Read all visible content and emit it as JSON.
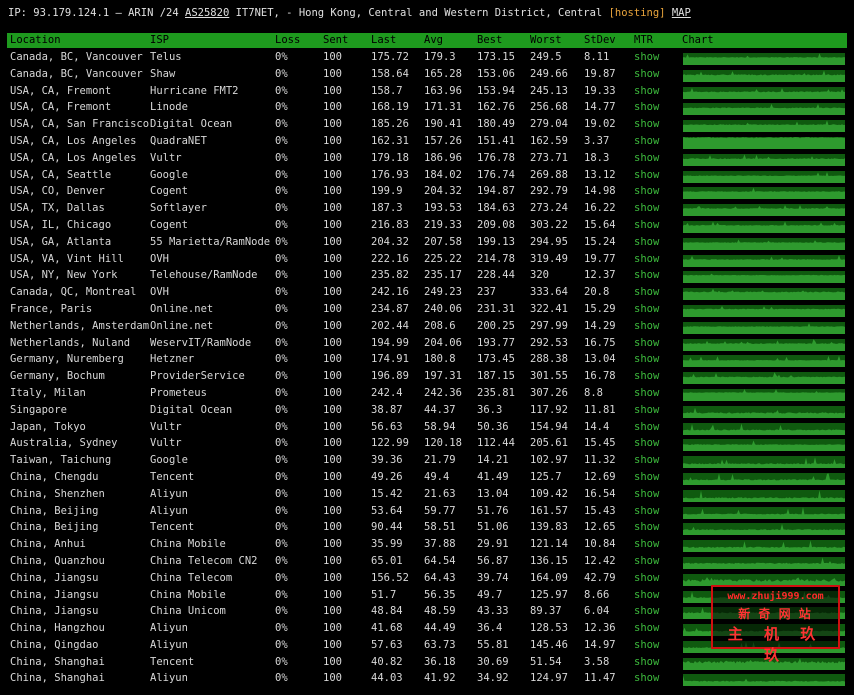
{
  "info": {
    "prefix": "IP: 93.179.124.1 – ARIN /24 ",
    "asn": "AS25820",
    "mid": " IT7NET, - Hong Kong, Central and Western District, Central ",
    "hosting": "hosting",
    "map": "MAP"
  },
  "columns": [
    "Location",
    "ISP",
    "Loss",
    "Sent",
    "Last",
    "Avg",
    "Best",
    "Worst",
    "StDev",
    "MTR",
    "Chart"
  ],
  "colors": {
    "header_bg": "#1e9a1e",
    "chart_green": "#2e9a2e",
    "chart_bg": "#0f5a0f",
    "mtr_link": "#3dbb3d",
    "hosting": "#e8a33b"
  },
  "rows": [
    [
      "Canada, BC, Vancouver",
      "Telus",
      "0%",
      "100",
      "175.72",
      "179.3",
      "173.15",
      "249.5",
      "8.11",
      "show"
    ],
    [
      "Canada, BC, Vancouver",
      "Shaw",
      "0%",
      "100",
      "158.64",
      "165.28",
      "153.06",
      "249.66",
      "19.87",
      "show"
    ],
    [
      "USA, CA, Fremont",
      "Hurricane FMT2",
      "0%",
      "100",
      "158.7",
      "163.96",
      "153.94",
      "245.13",
      "19.33",
      "show"
    ],
    [
      "USA, CA, Fremont",
      "Linode",
      "0%",
      "100",
      "168.19",
      "171.31",
      "162.76",
      "256.68",
      "14.77",
      "show"
    ],
    [
      "USA, CA, San Francisco",
      "Digital Ocean",
      "0%",
      "100",
      "185.26",
      "190.41",
      "180.49",
      "279.04",
      "19.02",
      "show"
    ],
    [
      "USA, CA, Los Angeles",
      "QuadraNET",
      "0%",
      "100",
      "162.31",
      "157.26",
      "151.41",
      "162.59",
      "3.37",
      "show"
    ],
    [
      "USA, CA, Los Angeles",
      "Vultr",
      "0%",
      "100",
      "179.18",
      "186.96",
      "176.78",
      "273.71",
      "18.3",
      "show"
    ],
    [
      "USA, CA, Seattle",
      "Google",
      "0%",
      "100",
      "176.93",
      "184.02",
      "176.74",
      "269.88",
      "13.12",
      "show"
    ],
    [
      "USA, CO, Denver",
      "Cogent",
      "0%",
      "100",
      "199.9",
      "204.32",
      "194.87",
      "292.79",
      "14.98",
      "show"
    ],
    [
      "USA, TX, Dallas",
      "Softlayer",
      "0%",
      "100",
      "187.3",
      "193.53",
      "184.63",
      "273.24",
      "16.22",
      "show"
    ],
    [
      "USA, IL, Chicago",
      "Cogent",
      "0%",
      "100",
      "216.83",
      "219.33",
      "209.08",
      "303.22",
      "15.64",
      "show"
    ],
    [
      "USA, GA, Atlanta",
      "55 Marietta/RamNode",
      "0%",
      "100",
      "204.32",
      "207.58",
      "199.13",
      "294.95",
      "15.24",
      "show"
    ],
    [
      "USA, VA, Vint Hill",
      "OVH",
      "0%",
      "100",
      "222.16",
      "225.22",
      "214.78",
      "319.49",
      "19.77",
      "show"
    ],
    [
      "USA, NY, New York",
      "Telehouse/RamNode",
      "0%",
      "100",
      "235.82",
      "235.17",
      "228.44",
      "320",
      "12.37",
      "show"
    ],
    [
      "Canada, QC, Montreal",
      "OVH",
      "0%",
      "100",
      "242.16",
      "249.23",
      "237",
      "333.64",
      "20.8",
      "show"
    ],
    [
      "France, Paris",
      "Online.net",
      "0%",
      "100",
      "234.87",
      "240.06",
      "231.31",
      "322.41",
      "15.29",
      "show"
    ],
    [
      "Netherlands, Amsterdam",
      "Online.net",
      "0%",
      "100",
      "202.44",
      "208.6",
      "200.25",
      "297.99",
      "14.29",
      "show"
    ],
    [
      "Netherlands, Nuland",
      "WeservIT/RamNode",
      "0%",
      "100",
      "194.99",
      "204.06",
      "193.77",
      "292.53",
      "16.75",
      "show"
    ],
    [
      "Germany, Nuremberg",
      "Hetzner",
      "0%",
      "100",
      "174.91",
      "180.8",
      "173.45",
      "288.38",
      "13.04",
      "show"
    ],
    [
      "Germany, Bochum",
      "ProviderService",
      "0%",
      "100",
      "196.89",
      "197.31",
      "187.15",
      "301.55",
      "16.78",
      "show"
    ],
    [
      "Italy, Milan",
      "Prometeus",
      "0%",
      "100",
      "242.4",
      "242.36",
      "235.81",
      "307.26",
      "8.8",
      "show"
    ],
    [
      "Singapore",
      "Digital Ocean",
      "0%",
      "100",
      "38.87",
      "44.37",
      "36.3",
      "117.92",
      "11.81",
      "show"
    ],
    [
      "Japan, Tokyo",
      "Vultr",
      "0%",
      "100",
      "56.63",
      "58.94",
      "50.36",
      "154.94",
      "14.4",
      "show"
    ],
    [
      "Australia, Sydney",
      "Vultr",
      "0%",
      "100",
      "122.99",
      "120.18",
      "112.44",
      "205.61",
      "15.45",
      "show"
    ],
    [
      "Taiwan, Taichung",
      "Google",
      "0%",
      "100",
      "39.36",
      "21.79",
      "14.21",
      "102.97",
      "11.32",
      "show"
    ],
    [
      "China, Chengdu",
      "Tencent",
      "0%",
      "100",
      "49.26",
      "49.4",
      "41.49",
      "125.7",
      "12.69",
      "show"
    ],
    [
      "China, Shenzhen",
      "Aliyun",
      "0%",
      "100",
      "15.42",
      "21.63",
      "13.04",
      "109.42",
      "16.54",
      "show"
    ],
    [
      "China, Beijing",
      "Aliyun",
      "0%",
      "100",
      "53.64",
      "59.77",
      "51.76",
      "161.57",
      "15.43",
      "show"
    ],
    [
      "China, Beijing",
      "Tencent",
      "0%",
      "100",
      "90.44",
      "58.51",
      "51.06",
      "139.83",
      "12.65",
      "show"
    ],
    [
      "China, Anhui",
      "China Mobile",
      "0%",
      "100",
      "35.99",
      "37.88",
      "29.91",
      "121.14",
      "10.84",
      "show"
    ],
    [
      "China, Quanzhou",
      "China Telecom CN2",
      "0%",
      "100",
      "65.01",
      "64.54",
      "56.87",
      "136.15",
      "12.42",
      "show"
    ],
    [
      "China, Jiangsu",
      "China Telecom",
      "0%",
      "100",
      "156.52",
      "64.43",
      "39.74",
      "164.09",
      "42.79",
      "show"
    ],
    [
      "China, Jiangsu",
      "China Mobile",
      "0%",
      "100",
      "51.7",
      "56.35",
      "49.7",
      "125.97",
      "8.66",
      "show"
    ],
    [
      "China, Jiangsu",
      "China Unicom",
      "0%",
      "100",
      "48.84",
      "48.59",
      "43.33",
      "89.37",
      "6.04",
      "show"
    ],
    [
      "China, Hangzhou",
      "Aliyun",
      "0%",
      "100",
      "41.68",
      "44.49",
      "36.4",
      "128.53",
      "12.36",
      "show"
    ],
    [
      "China, Qingdao",
      "Aliyun",
      "0%",
      "100",
      "57.63",
      "63.73",
      "55.81",
      "145.46",
      "14.97",
      "show"
    ],
    [
      "China, Shanghai",
      "Tencent",
      "0%",
      "100",
      "40.82",
      "36.18",
      "30.69",
      "51.54",
      "3.58",
      "show"
    ],
    [
      "China, Shanghai",
      "Aliyun",
      "0%",
      "100",
      "44.03",
      "41.92",
      "34.92",
      "124.97",
      "11.47",
      "show"
    ]
  ],
  "watermark": {
    "url": "www.zhuji999.com",
    "line2": "新 奇 网 站",
    "line3": "主 机 玖 玖"
  }
}
